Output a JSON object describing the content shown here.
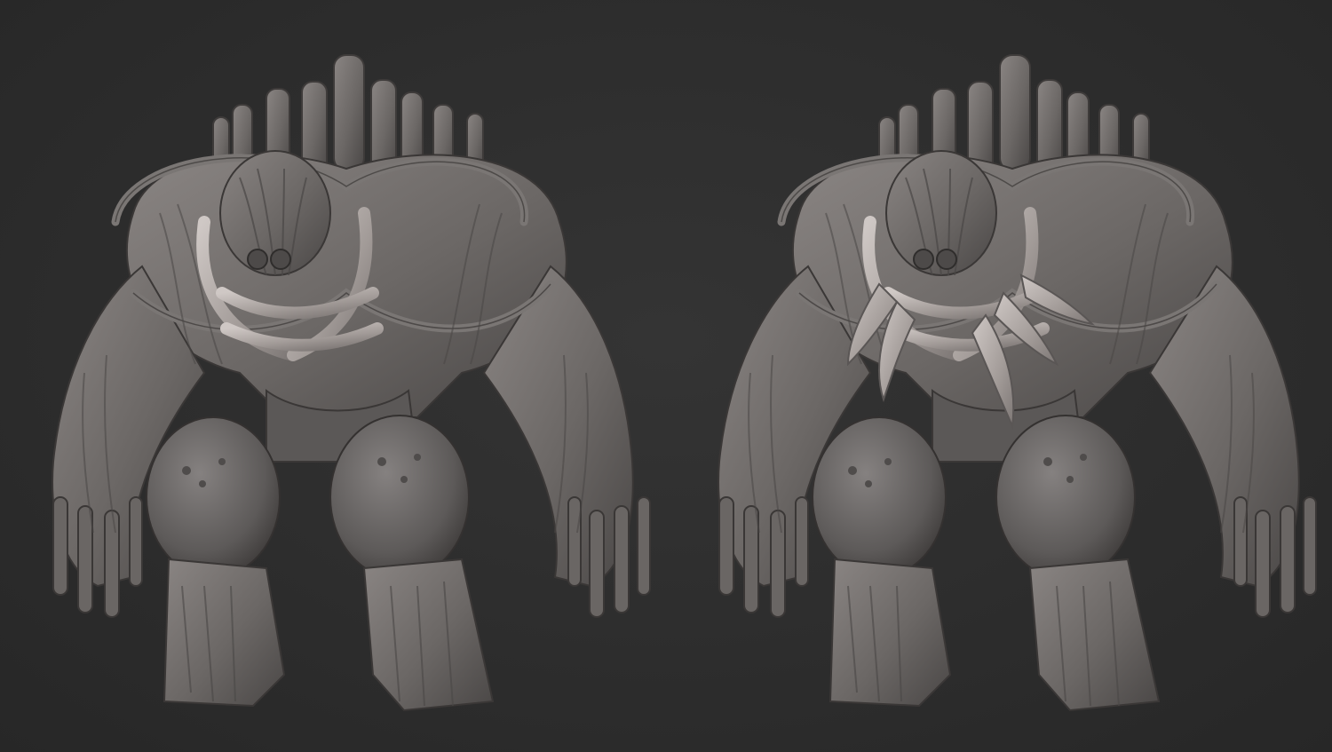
{
  "scene": {
    "background_color": "#2b2b2b",
    "clay_base_color": "#6e6a68",
    "clay_light_color": "#b9b2af",
    "clay_shadow_color": "#3e3b3a"
  },
  "renders": [
    {
      "variant": "without-chest-claws"
    },
    {
      "variant": "with-chest-claws"
    }
  ]
}
